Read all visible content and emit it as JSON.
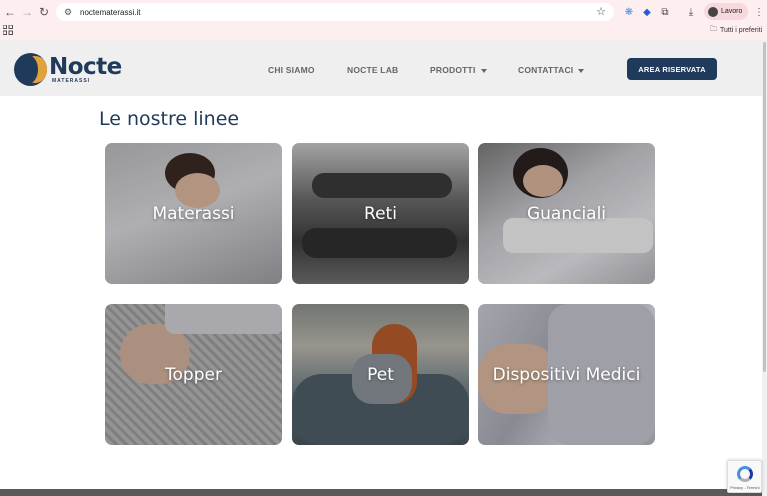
{
  "browser": {
    "url": "noctematerassi.it",
    "profile_name": "Lavoro",
    "bookmark_folder": "Tutti i preferiti"
  },
  "site": {
    "logo_word": "Nocte",
    "logo_sub": "MATERASSI",
    "nav": {
      "chi_siamo": "CHI SIAMO",
      "nocte_lab": "NOCTE LAB",
      "prodotti": "PRODOTTI",
      "contattaci": "CONTATTACI"
    },
    "area_button": "AREA RISERVATA"
  },
  "main": {
    "section_title": "Le nostre linee",
    "cards": [
      {
        "label": "Materassi"
      },
      {
        "label": "Reti"
      },
      {
        "label": "Guanciali"
      },
      {
        "label": "Topper"
      },
      {
        "label": "Pet"
      },
      {
        "label": "Dispositivi Medici"
      }
    ]
  },
  "colors": {
    "brand": "#1f3a5a",
    "accent": "#e0a23b",
    "chrome_bg": "#fdeef0"
  },
  "recaptcha": {
    "text": "Privacy - Termini"
  }
}
